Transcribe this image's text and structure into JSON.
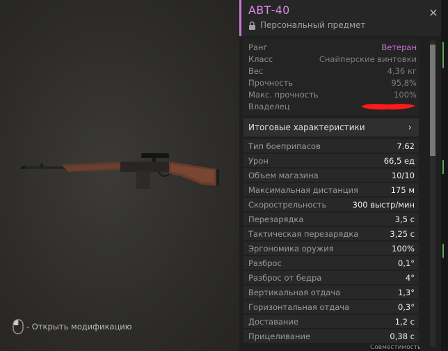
{
  "weapon_view": {
    "hint_text": "- Открыть модификацию"
  },
  "panel": {
    "title": "АВТ-40",
    "subtitle": "Персональный предмет",
    "info": [
      {
        "label": "Ранг",
        "value": "Ветеран"
      },
      {
        "label": "Класс",
        "value": "Снайперские винтовки"
      },
      {
        "label": "Вес",
        "value": "4,36 кг"
      },
      {
        "label": "Прочность",
        "value": "95,8%"
      },
      {
        "label": "Макс. прочность",
        "value": "100%"
      },
      {
        "label": "Владелец",
        "value": ""
      }
    ],
    "summary_label": "Итоговые характеристики",
    "stats": [
      {
        "label": "Тип боеприпасов",
        "value": "7.62"
      },
      {
        "label": "Урон",
        "value": "66,5 ед"
      },
      {
        "label": "Объем магазина",
        "value": "10/10"
      },
      {
        "label": "Максимальная дистанция",
        "value": "175 м"
      },
      {
        "label": "Скорострельность",
        "value": "300 выстр/мин"
      },
      {
        "label": "Перезарядка",
        "value": "3,5 с"
      },
      {
        "label": "Тактическая перезарядка",
        "value": "3,25 с"
      },
      {
        "label": "Эргономика оружия",
        "value": "100%"
      },
      {
        "label": "Разброс",
        "value": "0,1°"
      },
      {
        "label": "Разброс от бедра",
        "value": "4°"
      },
      {
        "label": "Вертикальная отдача",
        "value": "1,3°"
      },
      {
        "label": "Горизонтальная отдача",
        "value": "0,3°"
      },
      {
        "label": "Доставание",
        "value": "1,2 с"
      },
      {
        "label": "Прицеливание",
        "value": "0,38 с"
      }
    ],
    "bottom_partial": "Совместимость"
  },
  "colors": {
    "accent": "#c678d8",
    "rank": "#c86fd6",
    "redaction": "#ff1a1a"
  },
  "icons": {
    "close": "close-icon",
    "lock": "lock-icon",
    "mouse": "mouse-icon",
    "chevron": "chevron-right-icon"
  }
}
